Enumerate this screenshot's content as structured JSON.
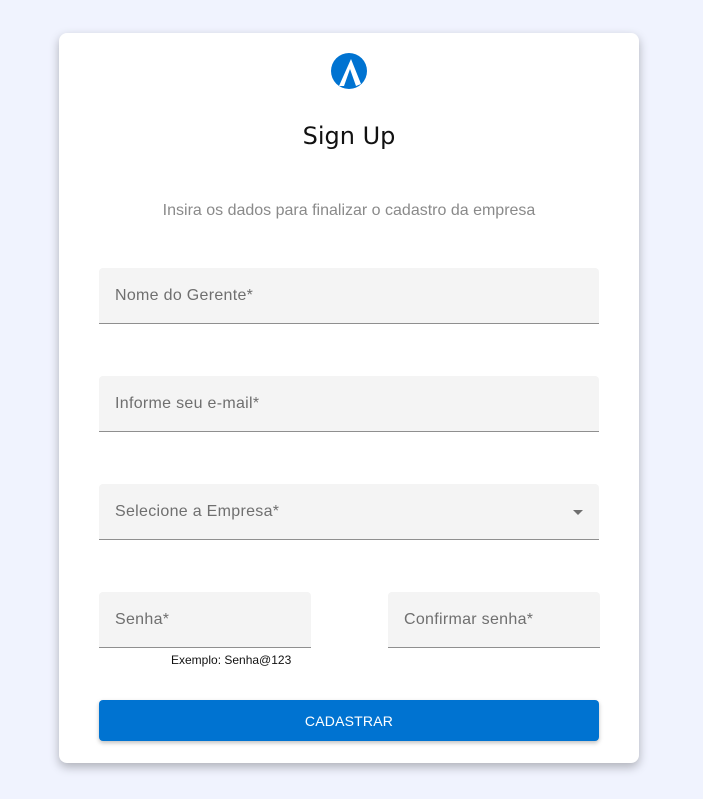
{
  "header": {
    "logo_icon": "brand-logo-icon",
    "title": "Sign Up",
    "subtitle": "Insira os dados para finalizar o cadastro da empresa"
  },
  "form": {
    "nome_placeholder": "Nome do Gerente*",
    "email_placeholder": "Informe seu e-mail*",
    "empresa_label": "Selecione a Empresa*",
    "empresa_icon": "caret-down-icon",
    "senha_placeholder": "Senha*",
    "confirmar_placeholder": "Confirmar senha*",
    "senha_hint": "Exemplo: Senha@123",
    "submit_label": "CADASTRAR"
  },
  "colors": {
    "accent": "#0073d1",
    "background": "#f0f3fe",
    "field_bg": "#f4f4f4"
  }
}
